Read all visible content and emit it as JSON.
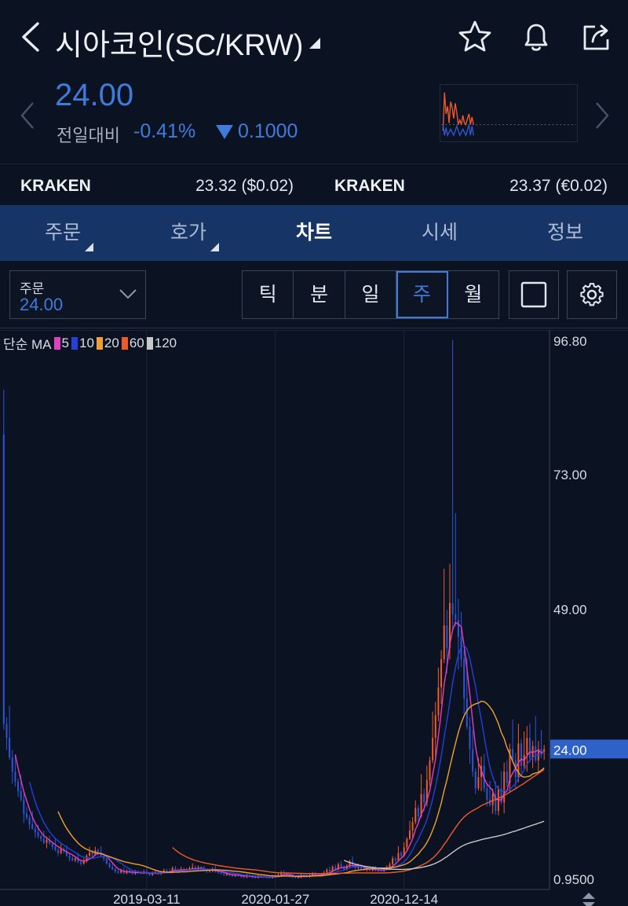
{
  "header": {
    "title": "시아코인(SC/KRW)",
    "icons": [
      "back-icon",
      "caret-down-icon",
      "star-icon",
      "bell-icon",
      "share-icon"
    ]
  },
  "ticker": {
    "price": "24.00",
    "change_label": "전일대비",
    "change_pct": "-0.41%",
    "change_value": "0.1000",
    "change_direction": "down",
    "color_down": "#3f7bdb"
  },
  "exchanges": [
    {
      "name": "KRAKEN",
      "value": "23.32 ($0.02)"
    },
    {
      "name": "KRAKEN",
      "value": "23.37 (€0.02)"
    }
  ],
  "tabs": [
    {
      "label": "주문",
      "active": false,
      "has_corner": true
    },
    {
      "label": "호가",
      "active": false,
      "has_corner": true
    },
    {
      "label": "차트",
      "active": true,
      "has_corner": false
    },
    {
      "label": "시세",
      "active": false,
      "has_corner": false
    },
    {
      "label": "정보",
      "active": false,
      "has_corner": false
    }
  ],
  "toolbar": {
    "order_label": "주문",
    "order_value": "24.00",
    "periods": [
      "틱",
      "분",
      "일",
      "주",
      "월"
    ],
    "active_period": "주",
    "tool_icons": [
      "square-icon",
      "gear-icon"
    ]
  },
  "chart_legend": {
    "label": "단순 MA",
    "items": [
      {
        "period": "5",
        "color": "#e040c0"
      },
      {
        "period": "10",
        "color": "#2440d8"
      },
      {
        "period": "20",
        "color": "#f0a030"
      },
      {
        "period": "60",
        "color": "#f05a28"
      },
      {
        "period": "120",
        "color": "#c8c8c8"
      }
    ]
  },
  "chart_data": {
    "type": "candlestick",
    "interval": "weekly",
    "y_ticks": [
      "96.80",
      "73.00",
      "49.00",
      "0.9500"
    ],
    "ylim": [
      0.95,
      96.8
    ],
    "x_ticks": [
      "2019-03-11",
      "2020-01-27",
      "2020-12-14"
    ],
    "current_price_label": "24.00",
    "colors": {
      "up": "#f05a28",
      "down": "#2f55d4"
    },
    "close": [
      28.5,
      26.0,
      22.5,
      20.0,
      18.2,
      16.5,
      15.0,
      12.5,
      11.8,
      10.6,
      9.8,
      9.2,
      8.5,
      8.0,
      7.3,
      7.8,
      7.2,
      6.6,
      6.0,
      5.5,
      6.2,
      5.8,
      5.0,
      4.6,
      4.2,
      4.5,
      3.9,
      3.6,
      4.0,
      5.0,
      5.6,
      5.2,
      6.0,
      5.5,
      5.0,
      4.5,
      3.6,
      3.0,
      2.6,
      2.2,
      2.0,
      2.4,
      1.9,
      2.3,
      2.0,
      1.8,
      2.1,
      2.0,
      1.9,
      2.2,
      1.8,
      1.6,
      1.9,
      2.1,
      1.8,
      2.0,
      2.4,
      2.2,
      2.1,
      2.8,
      2.5,
      2.3,
      2.6,
      2.4,
      2.5,
      2.8,
      3.0,
      2.6,
      2.9,
      2.7,
      2.4,
      2.2,
      2.3,
      2.6,
      2.2,
      2.0,
      1.8,
      1.6,
      1.8,
      1.5,
      1.4,
      1.6,
      1.5,
      1.3,
      1.2,
      1.5,
      1.3,
      1.2,
      1.1,
      1.3,
      1.4,
      1.2,
      1.1,
      1.0,
      1.3,
      1.4,
      1.6,
      2.0,
      1.8,
      1.5,
      1.3,
      1.2,
      1.1,
      1.2,
      1.6,
      1.4,
      1.3,
      1.5,
      1.8,
      1.6,
      1.5,
      1.6,
      2.0,
      2.5,
      2.2,
      3.0,
      2.6,
      3.5,
      3.0,
      2.6,
      3.2,
      4.0,
      3.4,
      2.8,
      3.2,
      2.7,
      2.5,
      2.8,
      2.4,
      2.6,
      2.4,
      2.5,
      2.3,
      2.6,
      2.8,
      3.5,
      4.5,
      4.2,
      5.5,
      5.0,
      6.5,
      8.0,
      9.5,
      11.0,
      13.5,
      12.0,
      16.0,
      14.5,
      18.5,
      22.0,
      26.0,
      30.0,
      35.0,
      40.0,
      46.0,
      42.0,
      50.0,
      48.0,
      47.0,
      44.0,
      40.0,
      33.0,
      28.0,
      24.0,
      20.0,
      17.0,
      19.0,
      21.0,
      17.0,
      15.0,
      14.0,
      16.0,
      13.0,
      17.0,
      14.5,
      20.0,
      18.0,
      24.0,
      22.0,
      19.0,
      25.0,
      21.0,
      23.0,
      26.0,
      22.5,
      24.5,
      22.0,
      24.0,
      23.5,
      24.0
    ]
  }
}
